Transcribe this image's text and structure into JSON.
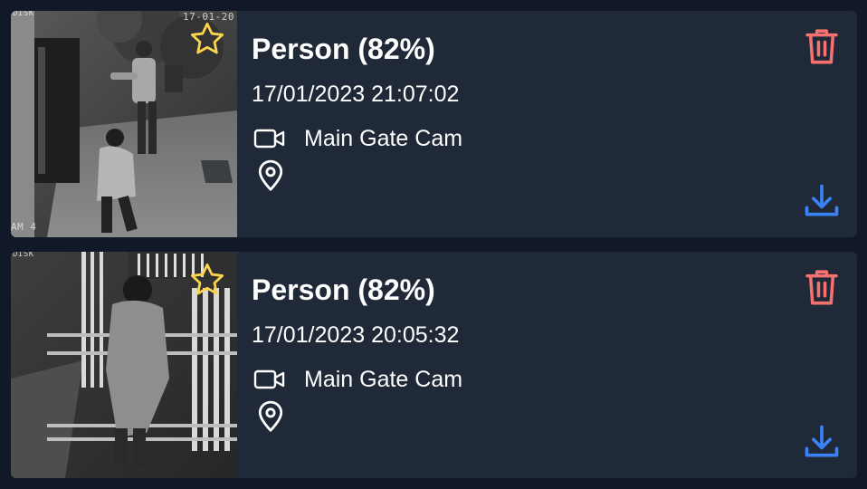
{
  "colors": {
    "page_background": "#111827",
    "card_background": "#1f2937",
    "text": "#ffffff",
    "star": "#fcd34d",
    "delete": "#f87171",
    "download": "#3b82f6"
  },
  "events": [
    {
      "title": "Person (82%)",
      "timestamp": "17/01/2023 21:07:02",
      "camera": "Main Gate Cam",
      "thumbnail_overlay": {
        "top": "17-01-20",
        "corner": "DISK",
        "bottom": "AM 4"
      },
      "icons": [
        "star-icon",
        "video-camera-icon",
        "map-pin-icon",
        "trash-icon",
        "download-icon"
      ]
    },
    {
      "title": "Person (82%)",
      "timestamp": "17/01/2023 20:05:32",
      "camera": "Main Gate Cam",
      "thumbnail_overlay": {
        "corner": "DISK"
      },
      "icons": [
        "star-icon",
        "video-camera-icon",
        "map-pin-icon",
        "trash-icon",
        "download-icon"
      ]
    }
  ]
}
